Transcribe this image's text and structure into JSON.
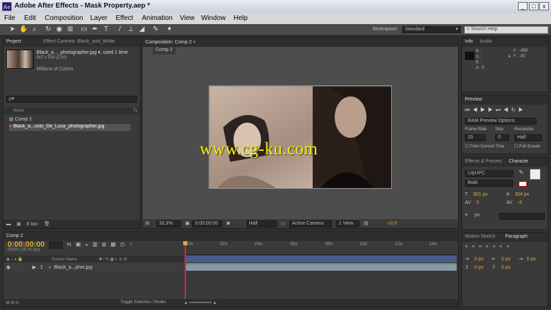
{
  "app": {
    "badge": "Ae",
    "title": "Adobe After Effects - Mask Property.aep *"
  },
  "window_controls": {
    "minimize": "_",
    "maximize": "□",
    "close": "x"
  },
  "menu": [
    "File",
    "Edit",
    "Composition",
    "Layer",
    "Effect",
    "Animation",
    "View",
    "Window",
    "Help"
  ],
  "toolbar": {
    "workspace_label": "Workspace:",
    "workspace_value": "Standard",
    "search_placeholder": "Search Help",
    "tools": [
      "selection-tool",
      "hand-tool",
      "zoom-tool",
      "rotate-tool",
      "camera-tool",
      "pan-behind-tool",
      "rectangle-tool",
      "pen-tool",
      "text-tool",
      "brush-tool",
      "clone-stamp-tool",
      "eraser-tool",
      "roto-brush-tool",
      "puppet-tool"
    ]
  },
  "project": {
    "tabs": [
      "Project",
      "Effect Controls: Black_and_White"
    ],
    "item_name": "Black_a..._photographer.jpg ▾, used 1 time",
    "item_dims": "567 x 319 (1.00)",
    "item_colors": "Millions of Colors",
    "search_placeholder": "ρ▾",
    "col_name": "Name",
    "col_type": "Ty",
    "items": [
      "Comp 2",
      "Black_a...usto_De_Luca_photographer.jpg"
    ],
    "bpc": "8 bpc"
  },
  "composition": {
    "tab": "Composition: Comp 2",
    "breadcrumb": "Comp 2",
    "zoom": "33.3%",
    "timecode": "0:00:00:00",
    "resolution": "Half",
    "camera": "Active Camera",
    "view": "1 View",
    "exposure": "+0.0"
  },
  "watermark": "www.cg-ku.com",
  "info": {
    "tabs": [
      "Info",
      "Audio"
    ],
    "r": "R :",
    "g": "G :",
    "b": "B :",
    "a": "A : 0",
    "x": "X : -459",
    "y": "Y : -30"
  },
  "preview": {
    "tab": "Preview",
    "ram_options": "RAM Preview Options",
    "frame_rate_label": "Frame Rate",
    "skip_label": "Skip",
    "resolution_label": "Resolution",
    "frame_rate": "15",
    "skip": "0",
    "resolution": "Half",
    "from_current": "From Current Time",
    "full_screen": "Full Screen"
  },
  "effects_tabs": [
    "Effects & Presets",
    "Characte"
  ],
  "character": {
    "font": "LilyUPC",
    "style": "Bold",
    "size": "901 px",
    "leading": "304 px",
    "tracking": "0",
    "tracking2": "-8",
    "stroke_unit": "px"
  },
  "motion_tabs": [
    "Motion Sketch",
    "Paragraph"
  ],
  "paragraph": {
    "v1": "0 px",
    "v2": "0 px",
    "v3": "0 px",
    "v4": "0 px",
    "v5": "0 px"
  },
  "timeline": {
    "tab": "Comp 2",
    "timecode": "0:00:00:00",
    "frame_info": "00000 (15.00 fps)",
    "col_source": "Source Name",
    "layer_num": "1",
    "layer_name": "Black_a...pher.jpg",
    "ruler": [
      "0s",
      "02s",
      "04s",
      "06s",
      "08s",
      "10s",
      "12s",
      "14s"
    ],
    "toggle_label": "Toggle Switches / Modes"
  },
  "colors": {
    "panel": "#3a3a3a",
    "accent_blue": "#6fa8e6",
    "timecode": "#e0a93b",
    "watermark": "#f6f000"
  }
}
